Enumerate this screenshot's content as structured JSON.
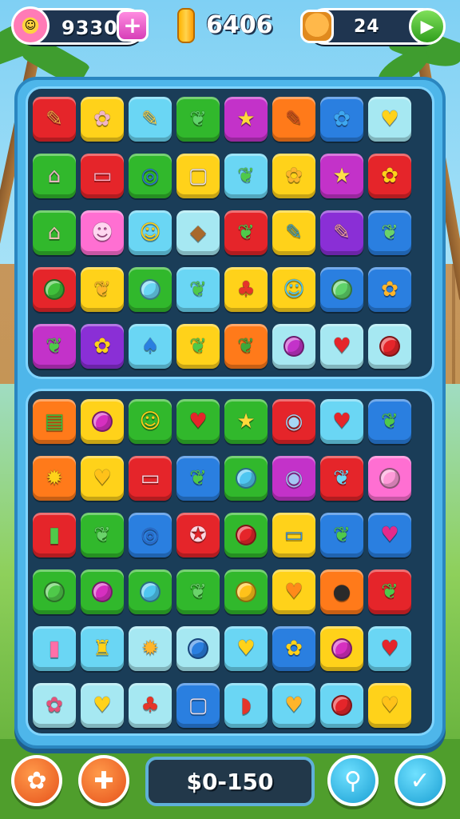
{
  "hud": {
    "score": "9330",
    "coins": "6406",
    "level": "24",
    "icons": {
      "score": "flower-icon",
      "add": "plus-icon",
      "coin": "coin-icon",
      "pet": "pet-icon",
      "play": "play-icon"
    }
  },
  "colors": {
    "red": "#e5252a",
    "yellow": "#ffd21a",
    "cyan": "#6ad6f4",
    "green": "#31b82c",
    "magenta": "#c332c9",
    "orange": "#ff7a1a",
    "blue": "#2a7fe0",
    "light": "#a6e8f2",
    "pink": "#ff6fd2",
    "purple": "#8a2fd6"
  },
  "board": {
    "top_panel": [
      [
        {
          "bg": "red",
          "icon": "pencil",
          "color": "#f4a340"
        },
        {
          "bg": "yellow",
          "icon": "flower",
          "color": "#f2b6c6"
        },
        {
          "bg": "cyan",
          "icon": "pencil",
          "color": "#f6d14a"
        },
        {
          "bg": "green",
          "icon": "leaf",
          "color": "#5fd36a"
        },
        {
          "bg": "magenta",
          "icon": "star",
          "color": "#ffd93a"
        },
        {
          "bg": "orange",
          "icon": "pencil",
          "color": "#d84f1a"
        },
        {
          "bg": "blue",
          "icon": "flower",
          "color": "#3ea7f0"
        },
        {
          "bg": "light",
          "icon": "heart",
          "color": "#ffd21a"
        }
      ],
      [
        {
          "bg": "green",
          "icon": "house",
          "color": "#e8b6c0"
        },
        {
          "bg": "red",
          "icon": "eraser",
          "color": "#ffb3c8"
        },
        {
          "bg": "green",
          "icon": "ring",
          "color": "#2a6fd8"
        },
        {
          "bg": "yellow",
          "icon": "square",
          "color": "#e9e2f3"
        },
        {
          "bg": "cyan",
          "icon": "leaf",
          "color": "#4fc94a"
        },
        {
          "bg": "yellow",
          "icon": "flower",
          "color": "#ffb52b"
        },
        {
          "bg": "magenta",
          "icon": "star",
          "color": "#ffe14a"
        },
        {
          "bg": "red",
          "icon": "flower",
          "color": "#ffd21a"
        }
      ],
      [
        {
          "bg": "green",
          "icon": "house",
          "color": "#e6c2b0"
        },
        {
          "bg": "pink",
          "icon": "cat",
          "color": "#ffd6f0"
        },
        {
          "bg": "cyan",
          "icon": "smile",
          "color": "#ffd21a"
        },
        {
          "bg": "light",
          "icon": "cookie",
          "color": "#a8692c"
        },
        {
          "bg": "red",
          "icon": "leaf",
          "color": "#4fc94a"
        },
        {
          "bg": "yellow",
          "icon": "pencil",
          "color": "#3aa0c0"
        },
        {
          "bg": "purple",
          "icon": "pencil",
          "color": "#f2a0a0"
        },
        {
          "bg": "blue",
          "icon": "leaf",
          "color": "#6ad36a"
        }
      ],
      [
        {
          "bg": "red",
          "icon": "egg",
          "color": "#3fbf3a"
        },
        {
          "bg": "yellow",
          "icon": "leaf",
          "color": "#ffb52b"
        },
        {
          "bg": "green",
          "icon": "balloon",
          "color": "#6ad6f4"
        },
        {
          "bg": "cyan",
          "icon": "leaf",
          "color": "#4fc94a"
        },
        {
          "bg": "yellow",
          "icon": "cherry",
          "color": "#e5352a"
        },
        {
          "bg": "yellow",
          "icon": "smile",
          "color": "#4fc6f0"
        },
        {
          "bg": "blue",
          "icon": "egg",
          "color": "#5fd36a"
        },
        {
          "bg": "blue",
          "icon": "flower",
          "color": "#ffb52b"
        }
      ],
      [
        {
          "bg": "magenta",
          "icon": "leaf",
          "color": "#4fc94a"
        },
        {
          "bg": "purple",
          "icon": "flower",
          "color": "#ffd21a"
        },
        {
          "bg": "cyan",
          "icon": "drop",
          "color": "#2a7fe0"
        },
        {
          "bg": "yellow",
          "icon": "leaf",
          "color": "#4fc94a"
        },
        {
          "bg": "orange",
          "icon": "leaf",
          "color": "#3fa83a"
        },
        {
          "bg": "light",
          "icon": "egg",
          "color": "#c332c9"
        },
        {
          "bg": "light",
          "icon": "strawberry",
          "color": "#e5252a"
        },
        {
          "bg": "light",
          "icon": "apple",
          "color": "#e5252a"
        }
      ]
    ],
    "bottom_panel": [
      [
        {
          "bg": "orange",
          "icon": "book",
          "color": "#3fbf3a"
        },
        {
          "bg": "yellow",
          "icon": "egg",
          "color": "#d62fc0"
        },
        {
          "bg": "green",
          "icon": "smile",
          "color": "#ffd21a"
        },
        {
          "bg": "green",
          "icon": "strawberry",
          "color": "#e5252a"
        },
        {
          "bg": "green",
          "icon": "star",
          "color": "#ffd93a"
        },
        {
          "bg": "red",
          "icon": "button",
          "color": "#a6d6f4"
        },
        {
          "bg": "cyan",
          "icon": "heart",
          "color": "#e5252a"
        },
        {
          "bg": "blue",
          "icon": "leaf",
          "color": "#4fc94a"
        }
      ],
      [
        {
          "bg": "orange",
          "icon": "sun",
          "color": "#ffd21a"
        },
        {
          "bg": "yellow",
          "icon": "heart",
          "color": "#ffc21a"
        },
        {
          "bg": "red",
          "icon": "eraser",
          "color": "#ffd6e0"
        },
        {
          "bg": "blue",
          "icon": "leaf",
          "color": "#4fc94a"
        },
        {
          "bg": "green",
          "icon": "apple",
          "color": "#4fc6f0"
        },
        {
          "bg": "magenta",
          "icon": "button",
          "color": "#a6c6f4"
        },
        {
          "bg": "red",
          "icon": "leaf",
          "color": "#6ad6f4"
        },
        {
          "bg": "pink",
          "icon": "egg",
          "color": "#ff9ad8"
        }
      ],
      [
        {
          "bg": "red",
          "icon": "tube",
          "color": "#4fc94a"
        },
        {
          "bg": "green",
          "icon": "leaf",
          "color": "#6ad36a"
        },
        {
          "bg": "blue",
          "icon": "ring",
          "color": "#2a6fd8"
        },
        {
          "bg": "red",
          "icon": "shell",
          "color": "#ffd6e0"
        },
        {
          "bg": "green",
          "icon": "apple",
          "color": "#e5252a"
        },
        {
          "bg": "yellow",
          "icon": "eraser",
          "color": "#3a8fd8"
        },
        {
          "bg": "blue",
          "icon": "leaf",
          "color": "#4fc94a"
        },
        {
          "bg": "blue",
          "icon": "strawberry",
          "color": "#e52a8a"
        }
      ],
      [
        {
          "bg": "green",
          "icon": "apple",
          "color": "#4fc94a"
        },
        {
          "bg": "green",
          "icon": "egg",
          "color": "#d62fc0"
        },
        {
          "bg": "green",
          "icon": "balloon",
          "color": "#4fc6f0"
        },
        {
          "bg": "green",
          "icon": "leaf",
          "color": "#6ad36a"
        },
        {
          "bg": "green",
          "icon": "apple",
          "color": "#ffc21a"
        },
        {
          "bg": "yellow",
          "icon": "heart",
          "color": "#ff8a1a"
        },
        {
          "bg": "orange",
          "icon": "bug",
          "color": "#2a2a2a"
        },
        {
          "bg": "red",
          "icon": "leaf",
          "color": "#4fc94a"
        }
      ],
      [
        {
          "bg": "cyan",
          "icon": "tube",
          "color": "#ff6fa8"
        },
        {
          "bg": "cyan",
          "icon": "bottle",
          "color": "#ffd21a"
        },
        {
          "bg": "light",
          "icon": "sun",
          "color": "#ffb52b"
        },
        {
          "bg": "light",
          "icon": "egg",
          "color": "#2a7fe0"
        },
        {
          "bg": "cyan",
          "icon": "heart",
          "color": "#ffd21a"
        },
        {
          "bg": "blue",
          "icon": "flower",
          "color": "#ffd21a"
        },
        {
          "bg": "yellow",
          "icon": "egg",
          "color": "#d62fc0"
        },
        {
          "bg": "cyan",
          "icon": "heart",
          "color": "#e5252a"
        }
      ],
      [
        {
          "bg": "light",
          "icon": "flower",
          "color": "#e5527a"
        },
        {
          "bg": "light",
          "icon": "heart",
          "color": "#ffd21a"
        },
        {
          "bg": "light",
          "icon": "cherry",
          "color": "#e5352a"
        },
        {
          "bg": "blue",
          "icon": "square",
          "color": "#e9e2f3"
        },
        {
          "bg": "cyan",
          "icon": "melon",
          "color": "#e5352a"
        },
        {
          "bg": "cyan",
          "icon": "heart",
          "color": "#ffb52b"
        },
        {
          "bg": "cyan",
          "icon": "apple",
          "color": "#e5252a"
        },
        {
          "bg": "yellow",
          "icon": "heart",
          "color": "#ffc21a"
        }
      ]
    ]
  },
  "bottom_bar": {
    "price": "$0-150",
    "left_buttons": [
      "shuffle-icon",
      "puzzle-icon"
    ],
    "right_buttons": [
      "search-icon",
      "checkmark-icon"
    ]
  }
}
